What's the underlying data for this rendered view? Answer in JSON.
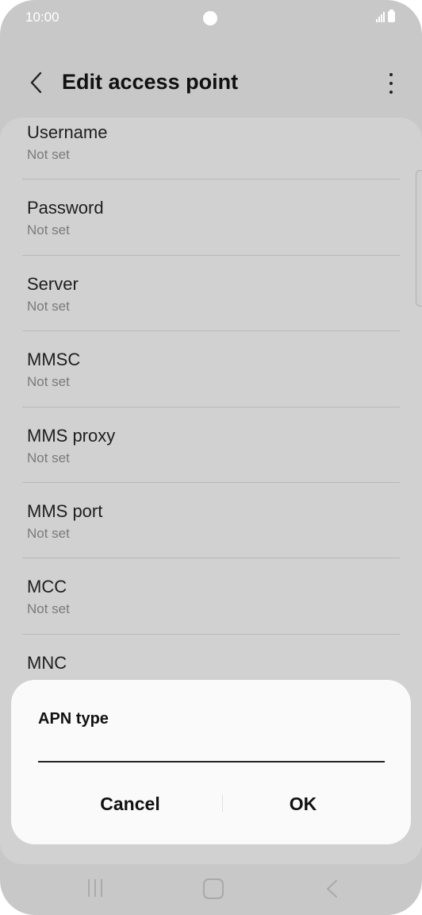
{
  "status_bar": {
    "time": "10:00"
  },
  "app_bar": {
    "title": "Edit access point",
    "back_icon": "chevron-left-icon",
    "more_icon": "more-vertical-icon"
  },
  "settings": {
    "items": [
      {
        "title": "Username",
        "value": "Not set"
      },
      {
        "title": "Password",
        "value": "Not set"
      },
      {
        "title": "Server",
        "value": "Not set"
      },
      {
        "title": "MMSC",
        "value": "Not set"
      },
      {
        "title": "MMS proxy",
        "value": "Not set"
      },
      {
        "title": "MMS port",
        "value": "Not set"
      },
      {
        "title": "MCC",
        "value": "Not set"
      },
      {
        "title": "MNC",
        "value": ""
      }
    ]
  },
  "dialog": {
    "title": "APN type",
    "input_value": "",
    "cancel_label": "Cancel",
    "ok_label": "OK"
  },
  "nav_bar": {
    "recent_icon": "recent-apps-icon",
    "home_icon": "home-icon",
    "back_icon": "back-icon"
  },
  "colors": {
    "background_dimmed": "#c8c8c8",
    "dialog_background": "#fafafa",
    "text_primary": "#111111",
    "text_secondary": "#7a7a7a"
  }
}
